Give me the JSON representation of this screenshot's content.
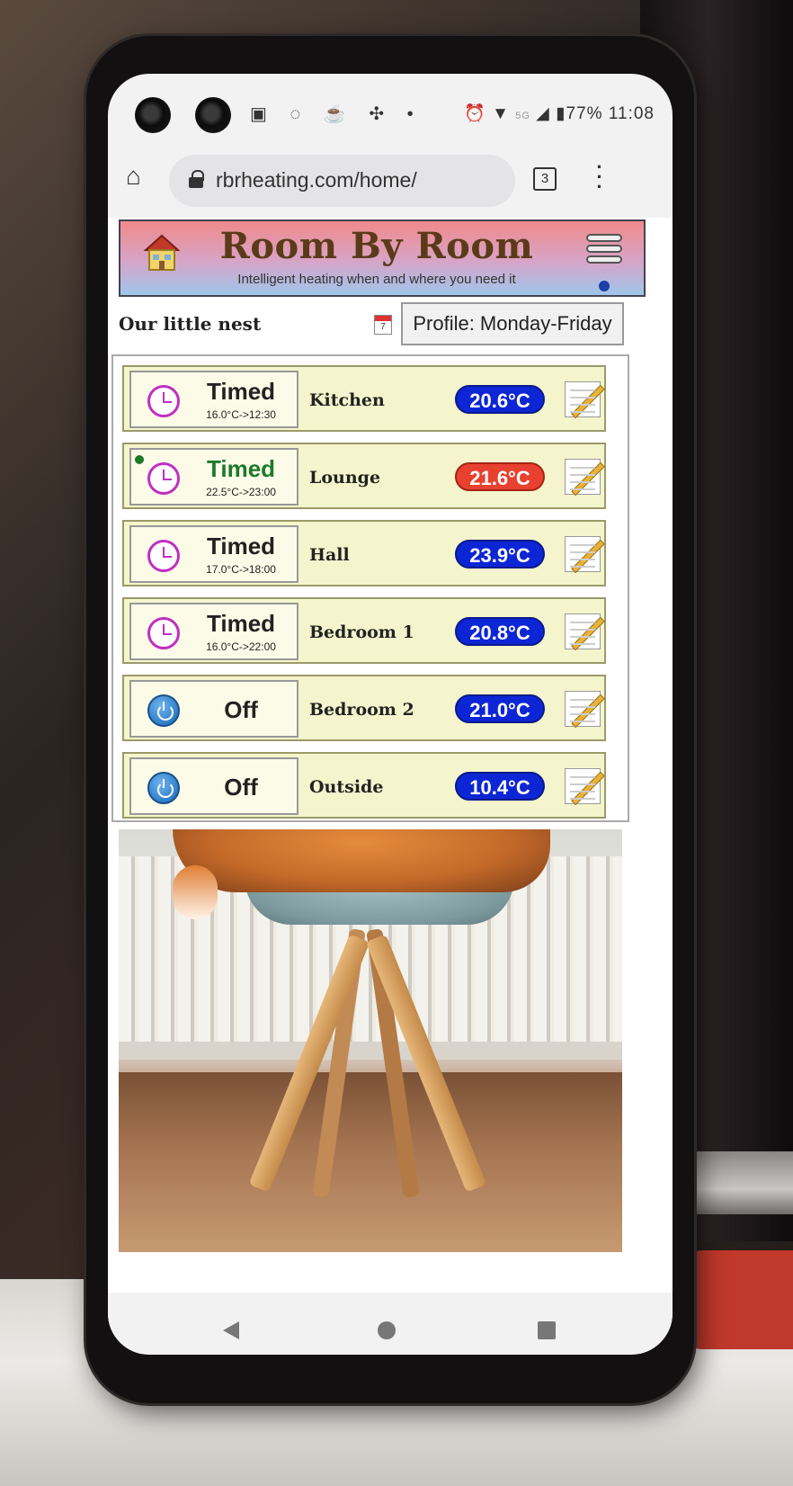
{
  "status_bar": {
    "battery": "77%",
    "time": "11:08",
    "network": "5G"
  },
  "browser": {
    "url": "rbrheating.com/home/",
    "tab_count": "3"
  },
  "banner": {
    "title": "Room By Room",
    "subtitle": "Intelligent heating when and where you need it"
  },
  "home": {
    "name": "Our little nest",
    "calendar_day": "7",
    "profile_label": "Profile: Monday-Friday"
  },
  "rooms": [
    {
      "name": "Kitchen",
      "mode": "Timed",
      "detail": "16.0°C->12:30",
      "temp": "20.6°C",
      "temp_state": "normal",
      "active": false
    },
    {
      "name": "Lounge",
      "mode": "Timed",
      "detail": "22.5°C->23:00",
      "temp": "21.6°C",
      "temp_state": "heating",
      "active": true
    },
    {
      "name": "Hall",
      "mode": "Timed",
      "detail": "17.0°C->18:00",
      "temp": "23.9°C",
      "temp_state": "normal",
      "active": false
    },
    {
      "name": "Bedroom 1",
      "mode": "Timed",
      "detail": "16.0°C->22:00",
      "temp": "20.8°C",
      "temp_state": "normal",
      "active": false
    },
    {
      "name": "Bedroom 2",
      "mode": "Off",
      "detail": "",
      "temp": "21.0°C",
      "temp_state": "normal",
      "active": false
    },
    {
      "name": "Outside",
      "mode": "Off",
      "detail": "",
      "temp": "10.4°C",
      "temp_state": "normal",
      "active": false
    }
  ],
  "colors": {
    "temp_normal": "#0c26d6",
    "temp_heating": "#e8412f",
    "room_bg": "#f4f5cc",
    "timed_icon": "#c02fc0",
    "active_text": "#1c7a2a"
  }
}
